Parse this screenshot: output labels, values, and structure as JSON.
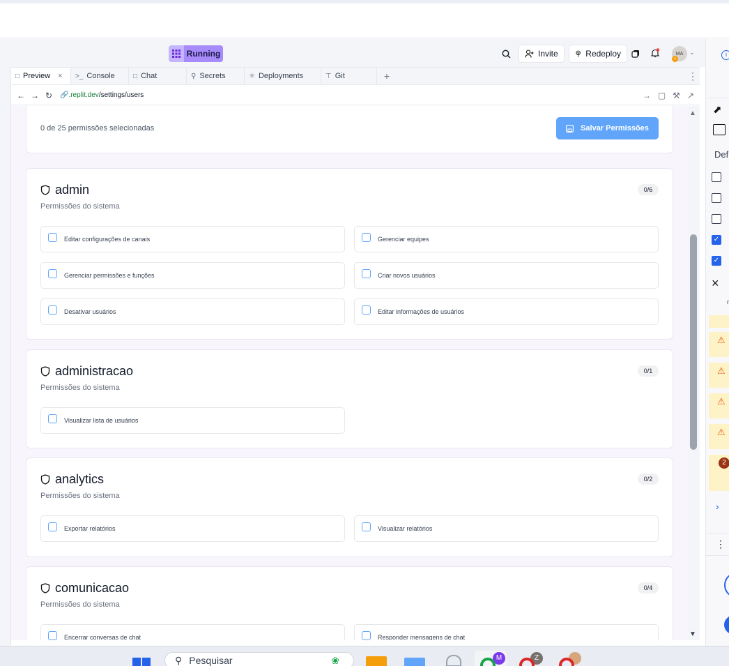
{
  "toolbar": {
    "status": "Running",
    "invite": "Invite",
    "redeploy": "Redeploy",
    "avatar_initials": "MA"
  },
  "tabs": [
    {
      "label": "Preview",
      "icon": "monitor-icon",
      "active": true
    },
    {
      "label": "Console",
      "icon": "terminal-icon"
    },
    {
      "label": "Chat",
      "icon": "chat-icon"
    },
    {
      "label": "Secrets",
      "icon": "lock-icon"
    },
    {
      "label": "Deployments",
      "icon": "deploy-icon"
    },
    {
      "label": "Git",
      "icon": "git-icon"
    }
  ],
  "url": {
    "domain": ".replit.dev",
    "path": "/settings/users"
  },
  "page": {
    "selected_count": "0 de 25 permissões selecionadas",
    "save_label": "Salvar Permissões"
  },
  "groups": [
    {
      "name": "admin",
      "subtitle": "Permissões do sistema",
      "count": "0/6",
      "perms": [
        "Editar configurações de canais",
        "Gerenciar equipes",
        "Gerenciar permissões e funções",
        "Criar novos usuários",
        "Desativar usuários",
        "Editar informações de usuários"
      ]
    },
    {
      "name": "administracao",
      "subtitle": "Permissões do sistema",
      "count": "0/1",
      "perms": [
        "Visualizar lista de usuários"
      ]
    },
    {
      "name": "analytics",
      "subtitle": "Permissões do sistema",
      "count": "0/2",
      "perms": [
        "Exportar relatórios",
        "Visualizar relatórios"
      ]
    },
    {
      "name": "comunicacao",
      "subtitle": "Permissões do sistema",
      "count": "0/4",
      "perms": [
        "Encerrar conversas de chat",
        "Responder mensagens de chat"
      ]
    }
  ],
  "right_panel": {
    "partial_text": "Def",
    "badge": "2",
    "partial_m": "m"
  },
  "taskbar": {
    "search_placeholder": "Pesquisar",
    "avatar_m": "M",
    "avatar_z": "Z"
  },
  "colors": {
    "accent": "#60a5fa",
    "running": "#a78bfa",
    "warning": "#ea580c"
  }
}
